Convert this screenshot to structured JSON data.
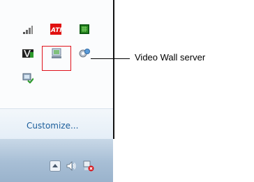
{
  "tray": {
    "icons": [
      {
        "name": "network-signal-icon"
      },
      {
        "name": "ati-catalyst-icon",
        "text": "ATI"
      },
      {
        "name": "green-chip-icon"
      },
      {
        "name": "v-app-icon",
        "text": "V"
      },
      {
        "name": "video-wall-server-icon"
      },
      {
        "name": "gear-settings-icon"
      },
      {
        "name": "network-check-icon"
      }
    ],
    "customize_label": "Customize..."
  },
  "taskbar": {
    "icons": [
      {
        "name": "show-hidden-icons-arrow"
      },
      {
        "name": "volume-icon"
      },
      {
        "name": "network-error-icon"
      }
    ]
  },
  "callout": {
    "label": "Video Wall server",
    "color": "#e0121b"
  }
}
